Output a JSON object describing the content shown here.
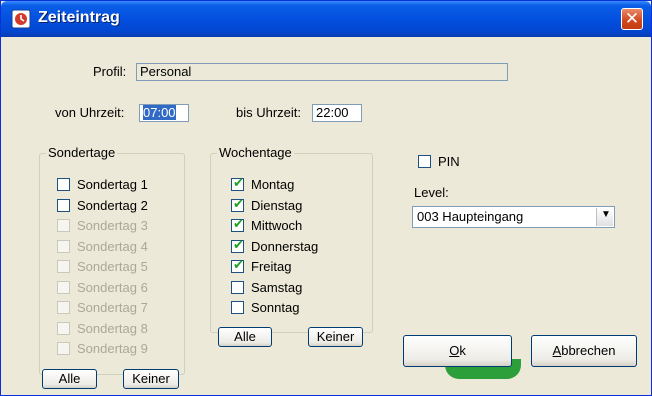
{
  "window": {
    "title": "Zeiteintrag",
    "close_symbol": "✕"
  },
  "profile": {
    "label": "Profil:",
    "value": "Personal"
  },
  "time": {
    "from_label": "von Uhrzeit:",
    "from_value": "07:00",
    "to_label": "bis Uhrzeit:",
    "to_value": "22:00"
  },
  "sondertage": {
    "title": "Sondertage",
    "items": [
      {
        "label": "Sondertag 1",
        "checked": false,
        "enabled": true
      },
      {
        "label": "Sondertag 2",
        "checked": false,
        "enabled": true
      },
      {
        "label": "Sondertag 3",
        "checked": false,
        "enabled": false
      },
      {
        "label": "Sondertag 4",
        "checked": false,
        "enabled": false
      },
      {
        "label": "Sondertag 5",
        "checked": false,
        "enabled": false
      },
      {
        "label": "Sondertag 6",
        "checked": false,
        "enabled": false
      },
      {
        "label": "Sondertag 7",
        "checked": false,
        "enabled": false
      },
      {
        "label": "Sondertag 8",
        "checked": false,
        "enabled": false
      },
      {
        "label": "Sondertag 9",
        "checked": false,
        "enabled": false
      }
    ],
    "all_label": "Alle",
    "none_label": "Keiner"
  },
  "wochentage": {
    "title": "Wochentage",
    "items": [
      {
        "label": "Montag",
        "checked": true
      },
      {
        "label": "Dienstag",
        "checked": true
      },
      {
        "label": "Mittwoch",
        "checked": true
      },
      {
        "label": "Donnerstag",
        "checked": true
      },
      {
        "label": "Freitag",
        "checked": true
      },
      {
        "label": "Samstag",
        "checked": false
      },
      {
        "label": "Sonntag",
        "checked": false
      }
    ],
    "all_label": "Alle",
    "none_label": "Keiner"
  },
  "pin": {
    "label": "PIN",
    "checked": false
  },
  "level": {
    "label": "Level:",
    "value": "003 Haupteingang"
  },
  "buttons": {
    "ok_label": "Ok",
    "ok_mnemonic": "O",
    "ok_rest": "k",
    "cancel_label": "Abbrechen",
    "cancel_mnemonic": "A",
    "cancel_rest": "bbrechen"
  },
  "colors": {
    "title_bar": "#0450e0",
    "dialog_bg": "#ece9d8",
    "check_mark": "#21a121",
    "selection": "#316ac5"
  }
}
